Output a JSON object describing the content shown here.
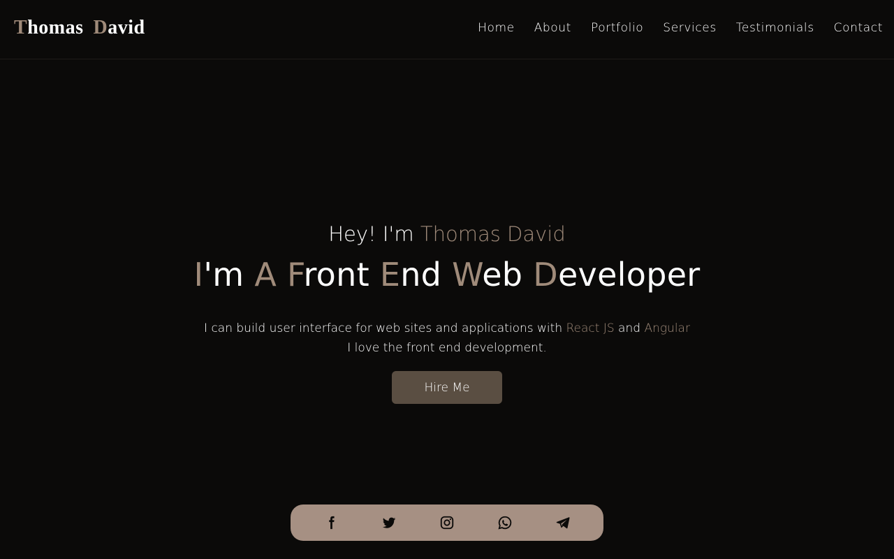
{
  "header": {
    "logo": {
      "first_initial": "T",
      "first_rest": "homas",
      "last_initial": "D",
      "last_rest": "avid"
    },
    "nav": [
      "Home",
      "About",
      "Portfolio",
      "Services",
      "Testimonials",
      "Contact"
    ]
  },
  "hero": {
    "greeting_prefix": "Hey! I'm ",
    "greeting_name": "Thomas David",
    "headline": [
      {
        "hl": "I",
        "rest": "'m "
      },
      {
        "hl": "A",
        "rest": " "
      },
      {
        "hl": "F",
        "rest": "ront "
      },
      {
        "hl": "E",
        "rest": "nd "
      },
      {
        "hl": "W",
        "rest": "eb "
      },
      {
        "hl": "D",
        "rest": "eveloper"
      }
    ],
    "desc_line1_prefix": "I can build user interface for web sites and applications with ",
    "desc_tech1": "React JS",
    "desc_and": " and ",
    "desc_tech2": "Angular",
    "desc_line2": "I love the front end development.",
    "cta_label": "Hire Me"
  },
  "social": {
    "icons": [
      "facebook-icon",
      "twitter-icon",
      "instagram-icon",
      "whatsapp-icon",
      "telegram-icon"
    ]
  },
  "colors": {
    "background": "#0b0a09",
    "accent": "#a08b7a",
    "button": "#5a4e42",
    "social_bar": "#a69083"
  }
}
